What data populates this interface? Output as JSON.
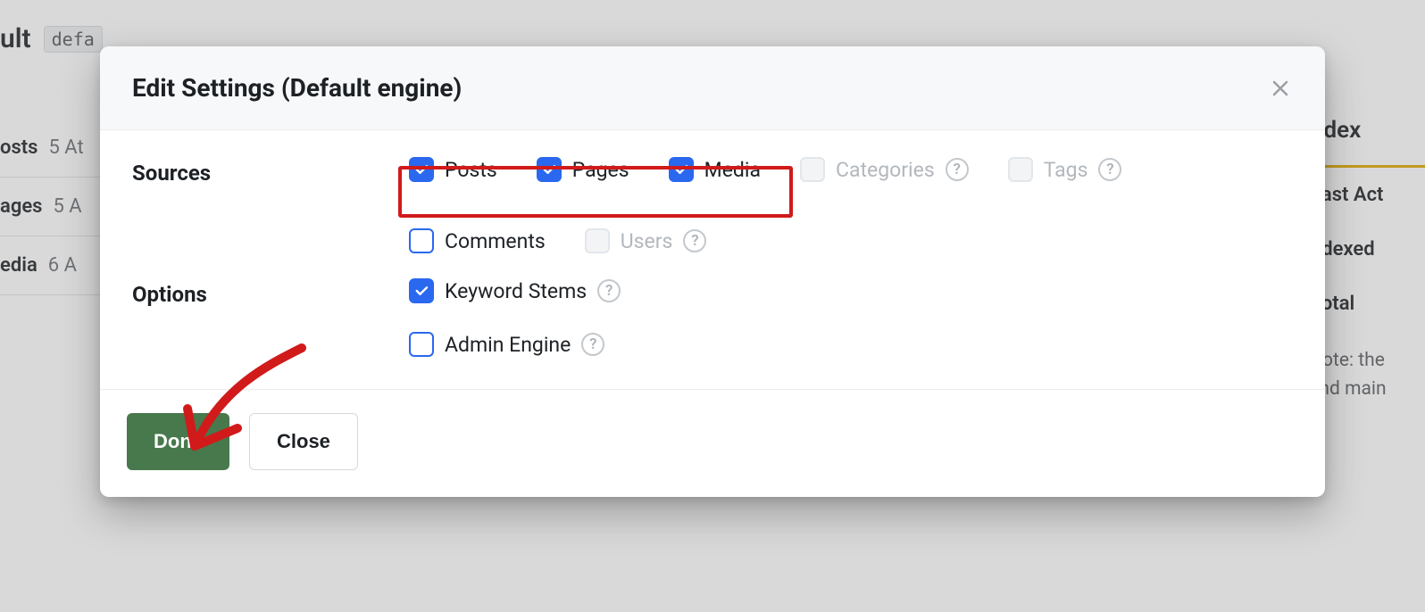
{
  "modal": {
    "title": "Edit Settings (Default engine)",
    "sections": {
      "sources_label": "Sources",
      "options_label": "Options"
    },
    "sources": {
      "posts": {
        "label": "Posts",
        "checked": true,
        "disabled": false,
        "help": false
      },
      "pages": {
        "label": "Pages",
        "checked": true,
        "disabled": false,
        "help": false
      },
      "media": {
        "label": "Media",
        "checked": true,
        "disabled": false,
        "help": false
      },
      "categories": {
        "label": "Categories",
        "checked": false,
        "disabled": true,
        "help": true
      },
      "tags": {
        "label": "Tags",
        "checked": false,
        "disabled": true,
        "help": true
      },
      "comments": {
        "label": "Comments",
        "checked": false,
        "disabled": false,
        "help": false
      },
      "users": {
        "label": "Users",
        "checked": false,
        "disabled": true,
        "help": true
      }
    },
    "options": {
      "keyword_stems": {
        "label": "Keyword Stems",
        "checked": true,
        "help": true
      },
      "admin_engine": {
        "label": "Admin Engine",
        "checked": false,
        "help": true
      }
    },
    "buttons": {
      "done": "Done",
      "close": "Close"
    }
  },
  "background": {
    "title_fragment": "ult",
    "slug_fragment": "defa",
    "index_label_fragment": "ndex",
    "rows": {
      "posts": {
        "label": "osts",
        "meta": "5 At"
      },
      "pages": {
        "label": "ages",
        "meta": "5 A"
      },
      "media": {
        "label": "edia",
        "meta": "6 A"
      }
    },
    "right": {
      "last_action": "Last Act",
      "indexed": "ndexed",
      "total": "Total",
      "note1": "Note: the",
      "note2": "and main"
    }
  },
  "annotation": {
    "highlight_color": "#d11a1a"
  }
}
